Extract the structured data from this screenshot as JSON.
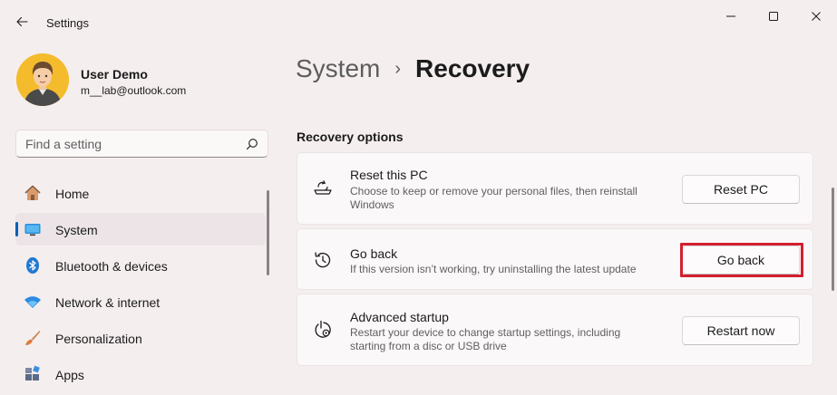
{
  "window": {
    "app_title": "Settings"
  },
  "profile": {
    "name": "User Demo",
    "email": "m__lab@outlook.com"
  },
  "search": {
    "placeholder": "Find a setting"
  },
  "nav": {
    "items": [
      {
        "label": "Home",
        "icon": "home-icon",
        "active": false
      },
      {
        "label": "System",
        "icon": "system-display-icon",
        "active": true
      },
      {
        "label": "Bluetooth & devices",
        "icon": "bluetooth-icon",
        "active": false
      },
      {
        "label": "Network & internet",
        "icon": "wifi-icon",
        "active": false
      },
      {
        "label": "Personalization",
        "icon": "paintbrush-icon",
        "active": false
      },
      {
        "label": "Apps",
        "icon": "apps-icon",
        "active": false
      }
    ]
  },
  "header": {
    "parent": "System",
    "separator": "›",
    "current": "Recovery"
  },
  "recovery": {
    "section_title": "Recovery options",
    "options": [
      {
        "title": "Reset this PC",
        "description": "Choose to keep or remove your personal files, then reinstall Windows",
        "button": "Reset PC",
        "icon": "reset-pc-icon"
      },
      {
        "title": "Go back",
        "description": "If this version isn’t working, try uninstalling the latest update",
        "button": "Go back",
        "icon": "history-icon"
      },
      {
        "title": "Advanced startup",
        "description": "Restart your device to change startup settings, including starting from a disc or USB drive",
        "button": "Restart now",
        "icon": "advanced-startup-icon"
      }
    ]
  },
  "colors": {
    "accent": "#005fb8",
    "highlight": "#d3202f",
    "background": "#f5eeef"
  }
}
